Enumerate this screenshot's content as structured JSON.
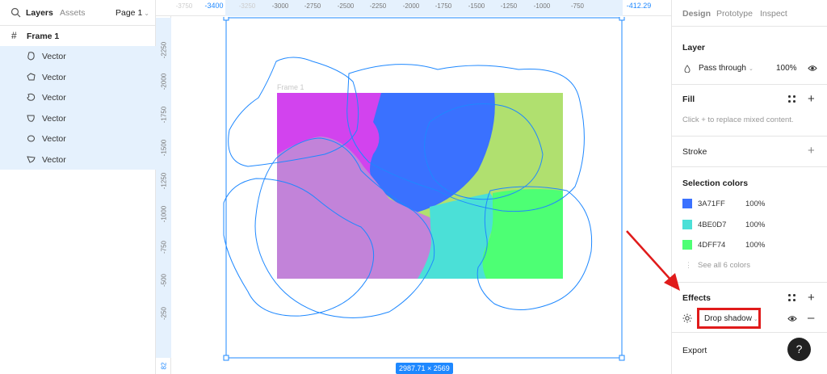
{
  "left_panel": {
    "tabs": [
      "Layers",
      "Assets"
    ],
    "page_selector": "Page 1",
    "frame_label": "Frame 1",
    "layers": [
      {
        "label": "Vector",
        "icon": "vector-icon"
      },
      {
        "label": "Vector",
        "icon": "vector-icon"
      },
      {
        "label": "Vector",
        "icon": "vector-icon"
      },
      {
        "label": "Vector",
        "icon": "vector-icon"
      },
      {
        "label": "Vector",
        "icon": "vector-icon"
      },
      {
        "label": "Vector",
        "icon": "vector-icon"
      }
    ]
  },
  "ruler": {
    "top_ticks": [
      "-3750",
      "-3400",
      "-3250",
      "-3000",
      "-2750",
      "-2500",
      "-2250",
      "-2000",
      "-1750",
      "-1500",
      "-1250",
      "-1000",
      "-750",
      "-412.29"
    ],
    "left_ticks": [
      "-2250",
      "-2000",
      "-1750",
      "-1500",
      "-1250",
      "-1000",
      "-750",
      "-500",
      "-250",
      "82"
    ]
  },
  "canvas": {
    "frame_name": "Frame 1",
    "selection_size": "2987.71 × 2569",
    "fill_colors": [
      "#d243ee",
      "#3a71ff",
      "#b0e06f",
      "#c283d9",
      "#4be0d7",
      "#4dff74"
    ],
    "outline_color": "#1e88ff"
  },
  "right_panel": {
    "tabs": [
      "Design",
      "Prototype",
      "Inspect"
    ],
    "layer": {
      "title": "Layer",
      "blend_mode": "Pass through",
      "opacity": "100%"
    },
    "fill": {
      "title": "Fill",
      "hint": "Click + to replace mixed content."
    },
    "stroke": {
      "title": "Stroke"
    },
    "selection_colors": {
      "title": "Selection colors",
      "colors": [
        {
          "hex": "3A71FF",
          "opacity": "100%",
          "swatch": "#3A71FF"
        },
        {
          "hex": "4BE0D7",
          "opacity": "100%",
          "swatch": "#4BE0D7"
        },
        {
          "hex": "4DFF74",
          "opacity": "100%",
          "swatch": "#4DFF74"
        }
      ],
      "see_all": "See all 6 colors"
    },
    "effects": {
      "title": "Effects",
      "effect_type": "Drop shadow"
    },
    "export": {
      "title": "Export"
    },
    "help": "?"
  },
  "annotation": {
    "highlight_color": "#e01b1b"
  }
}
